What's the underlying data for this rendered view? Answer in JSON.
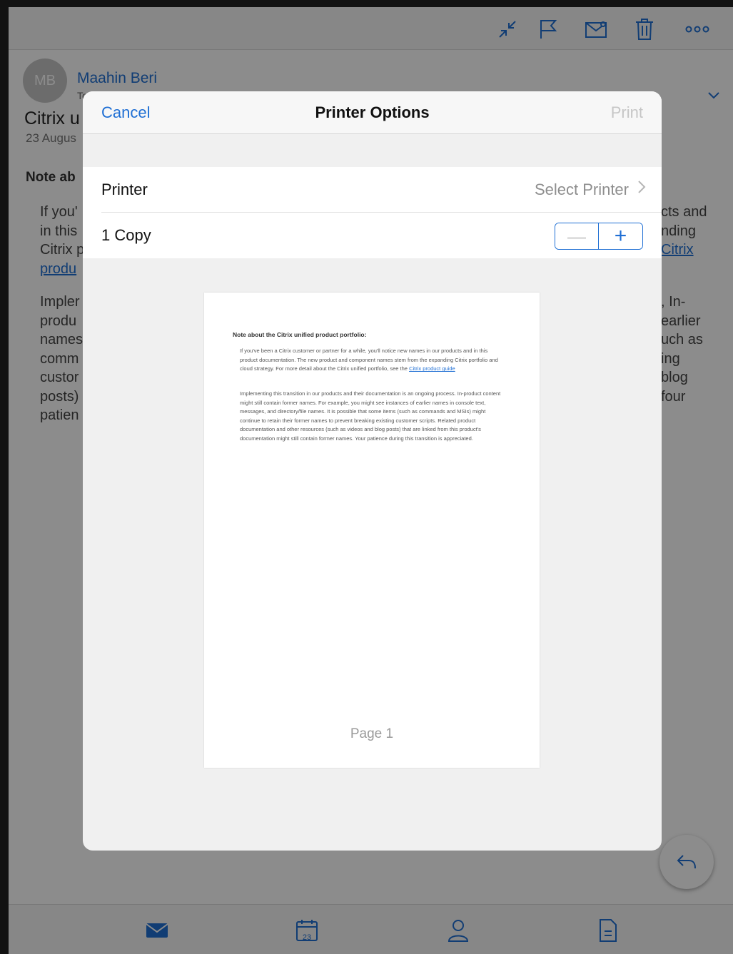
{
  "email": {
    "avatar_initials": "MB",
    "sender": "Maahin Beri",
    "sender_sub": "To",
    "subject": "Citrix u",
    "date": "23 Augus",
    "note_heading": "Note ab",
    "left_fragments": [
      "If you'",
      "in this",
      "Citrix p",
      "produ"
    ],
    "left_fragments_2": [
      "Impler",
      "produ",
      "names",
      "comm",
      "custor",
      "posts)",
      "patien"
    ],
    "right_fragments": [
      "cts and",
      "nding",
      "Citrix"
    ],
    "right_fragments_2": [
      ", In-",
      "earlier",
      "uch as",
      "ing",
      "blog",
      "four"
    ]
  },
  "modal": {
    "cancel_label": "Cancel",
    "title": "Printer Options",
    "print_label": "Print",
    "printer_label": "Printer",
    "printer_value": "Select Printer",
    "copies_label": "1 Copy",
    "minus_label": "—",
    "plus_label": "+"
  },
  "preview": {
    "heading": "Note about the Citrix unified product portfolio:",
    "para1": "If you've been a Citrix customer or partner for a while, you'll notice new names in our products and in this product documentation. The new product and component names stem from the expanding Citrix portfolio and cloud strategy. For more detail about the Citrix unified portfolio, see the",
    "para1_link": "Citrix product guide",
    "para2": "Implementing this transition in our products and their documentation is an ongoing process. In-product content might still contain former names. For example, you might see instances of earlier names in console text, messages, and directory/file names. It is possible that some items (such as commands and MSIs) might continue to retain their former names to prevent breaking existing customer scripts. Related product documentation and other resources (such as videos and blog posts) that are linked from this product's documentation might still contain former names. Your patience during this transition is appreciated.",
    "footer": "Page 1"
  },
  "tabbar": {
    "tab_calendar_day": "23"
  },
  "colors": {
    "accent": "#1f6fd4",
    "disabled": "#c6c6c6"
  }
}
